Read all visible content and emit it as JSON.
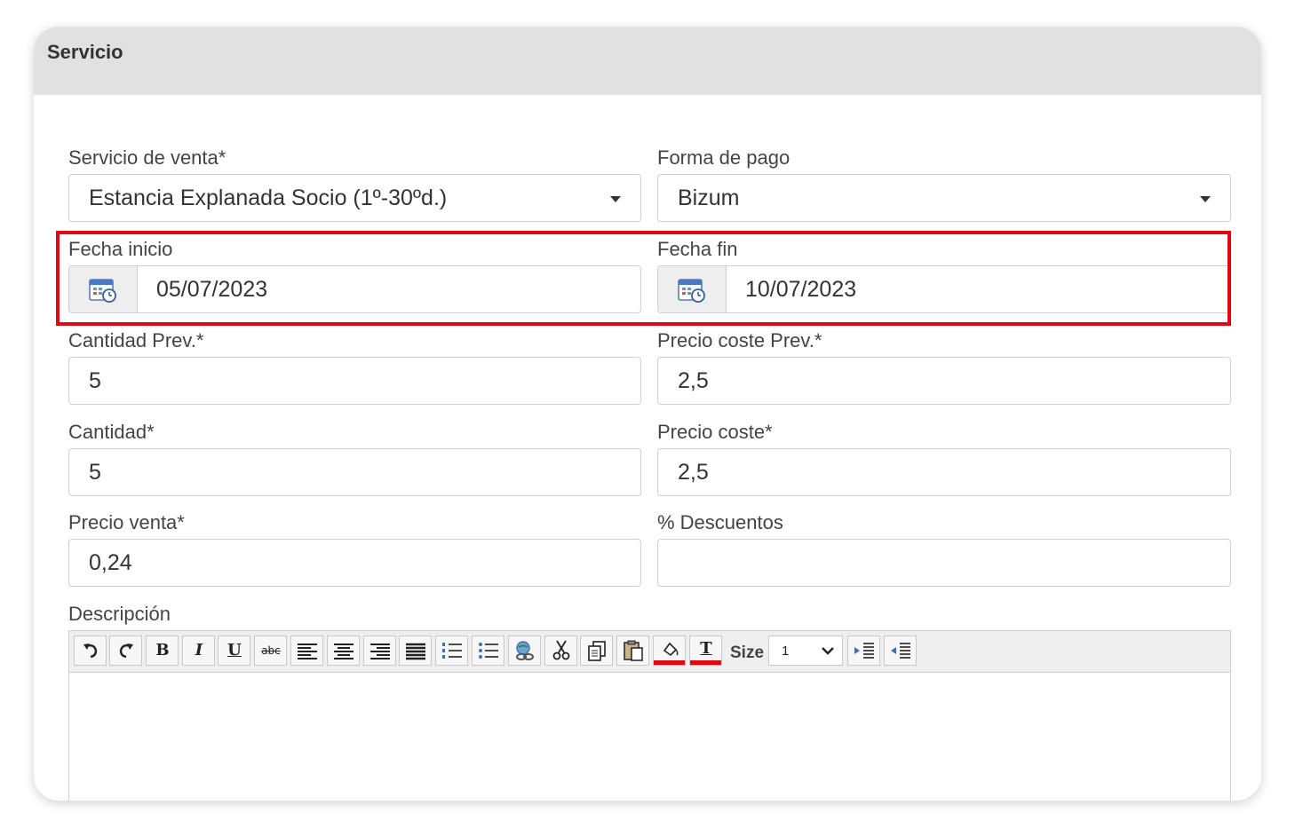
{
  "panel": {
    "title": "Servicio"
  },
  "form": {
    "servicio_venta": {
      "label": "Servicio de venta*",
      "value": "Estancia Explanada Socio (1º-30ºd.)"
    },
    "forma_pago": {
      "label": "Forma de pago",
      "value": "Bizum"
    },
    "fecha_inicio": {
      "label": "Fecha inicio",
      "value": "05/07/2023",
      "icon": "calendar-icon"
    },
    "fecha_fin": {
      "label": "Fecha fin",
      "value": "10/07/2023",
      "icon": "calendar-icon"
    },
    "cantidad_prev": {
      "label": "Cantidad Prev.*",
      "value": "5"
    },
    "precio_coste_prev": {
      "label": "Precio coste Prev.*",
      "value": "2,5"
    },
    "cantidad": {
      "label": "Cantidad*",
      "value": "5"
    },
    "precio_coste": {
      "label": "Precio coste*",
      "value": "2,5"
    },
    "precio_venta": {
      "label": "Precio venta*",
      "value": "0,24"
    },
    "descuentos": {
      "label": "% Descuentos",
      "value": ""
    },
    "descripcion": {
      "label": "Descripción"
    }
  },
  "editor_toolbar": {
    "buttons": [
      "undo-icon",
      "redo-icon",
      "bold",
      "italic",
      "underline",
      "strikethrough",
      "align-left-icon",
      "align-center-icon",
      "align-right-icon",
      "align-justify-icon",
      "ordered-list-icon",
      "unordered-list-icon",
      "link-icon",
      "cut-icon",
      "copy-icon",
      "paste-icon",
      "highlight-color-icon",
      "text-color-icon",
      "indent-icon",
      "outdent-icon"
    ],
    "bold_glyph": "B",
    "italic_glyph": "I",
    "underline_glyph": "U",
    "strike_glyph": "abc",
    "text_color_glyph": "T",
    "size_label": "Size",
    "size_value": "1",
    "accent_color": "#e30613"
  },
  "highlight_color": "#e30613"
}
